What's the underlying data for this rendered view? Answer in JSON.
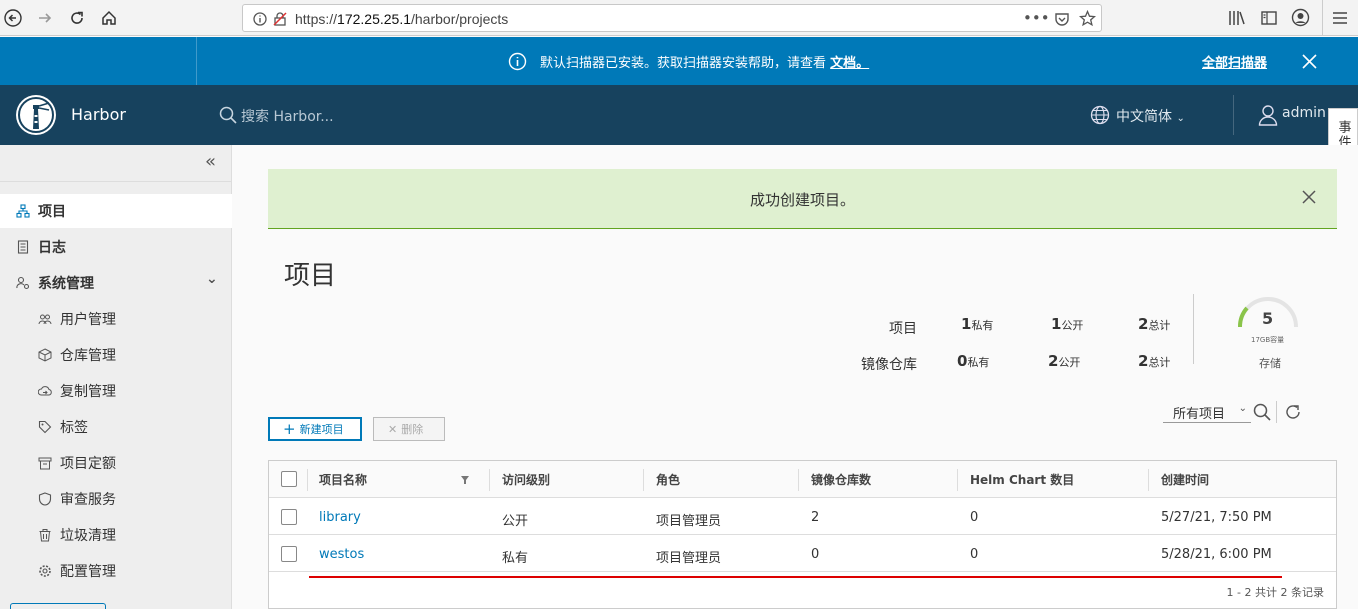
{
  "browser": {
    "url_prefix": "https://",
    "url_host": "172.25.25.1",
    "url_path": "/harbor/projects"
  },
  "alert": {
    "message": "默认扫描器已安装。获取扫描器安装帮助，请查看",
    "link": "文档。",
    "action": "全部扫描器"
  },
  "header": {
    "brand": "Harbor",
    "search_placeholder": "搜索 Harbor...",
    "language": "中文简体",
    "user": "admin",
    "event_log": "事件日志"
  },
  "sidebar": {
    "items": [
      {
        "label": "项目",
        "icon": "projects-icon",
        "active": true
      },
      {
        "label": "日志",
        "icon": "logs-icon"
      },
      {
        "label": "系统管理",
        "icon": "admin-icon"
      },
      {
        "label": "用户管理",
        "icon": "users-icon"
      },
      {
        "label": "仓库管理",
        "icon": "registry-icon"
      },
      {
        "label": "复制管理",
        "icon": "replication-icon"
      },
      {
        "label": "标签",
        "icon": "tag-icon"
      },
      {
        "label": "项目定额",
        "icon": "quota-icon"
      },
      {
        "label": "审查服务",
        "icon": "interrogation-icon"
      },
      {
        "label": "垃圾清理",
        "icon": "trash-icon"
      },
      {
        "label": "配置管理",
        "icon": "config-icon"
      }
    ]
  },
  "main": {
    "success_message": "成功创建项目。",
    "title": "项目",
    "stats": {
      "projects_label": "项目",
      "repos_label": "镜像仓库",
      "projects": {
        "private": "1",
        "public": "1",
        "total": "2"
      },
      "repos": {
        "private": "0",
        "public": "2",
        "total": "2"
      },
      "private_unit": "私有",
      "public_unit": "公开",
      "total_unit": "总计"
    },
    "storage": {
      "value": "5",
      "capacity": "17GB容量",
      "label": "存储"
    },
    "new_project": "新建项目",
    "delete": "删除",
    "filter": "所有项目",
    "table": {
      "headers": [
        "项目名称",
        "访问级别",
        "角色",
        "镜像仓库数",
        "Helm Chart 数目",
        "创建时间"
      ],
      "rows": [
        [
          "library",
          "公开",
          "项目管理员",
          "2",
          "0",
          "5/27/21, 7:50 PM"
        ],
        [
          "westos",
          "私有",
          "项目管理员",
          "0",
          "0",
          "5/28/21, 6:00 PM"
        ]
      ],
      "footer": "1 - 2 共计 2 条记录"
    }
  },
  "colors": {
    "primary": "#0079b8",
    "header": "#17425e",
    "success_bg": "#dff0d0",
    "annotation": "#dd0000"
  }
}
